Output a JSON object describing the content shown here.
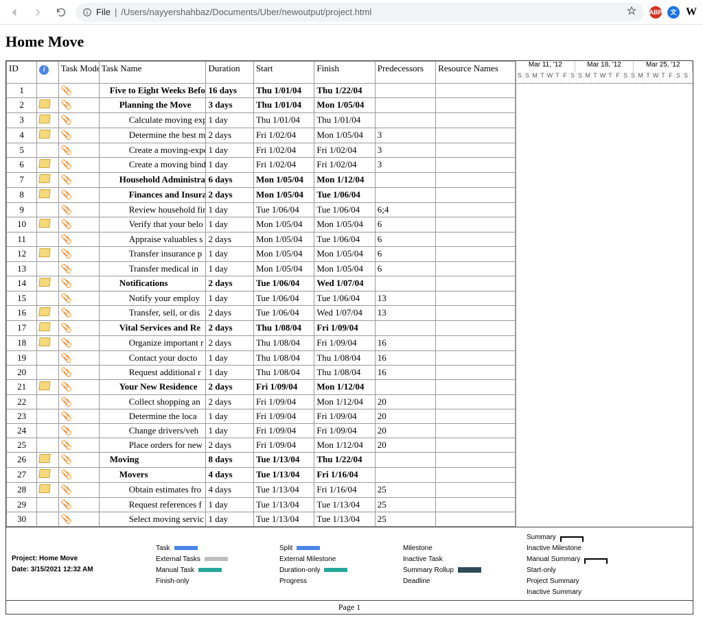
{
  "browser": {
    "file_label": "File",
    "path": "/Users/nayyershahbaz/Documents/Uber/newoutput/project.html"
  },
  "title": "Home Move",
  "columns": {
    "id": "ID",
    "info": "",
    "mode": "Task Mode",
    "name": "Task Name",
    "duration": "Duration",
    "start": "Start",
    "finish": "Finish",
    "pred": "Predecessors",
    "res": "Resource Names"
  },
  "timeline": {
    "weeks": [
      "Mar 11, '12",
      "Mar 18, '12",
      "Mar 25, '12"
    ],
    "days": [
      "S",
      "S",
      "M",
      "T",
      "W",
      "T",
      "F",
      "S",
      "S",
      "M",
      "T",
      "W",
      "T",
      "F",
      "S",
      "S",
      "M",
      "T",
      "W",
      "T",
      "F",
      "S",
      "S"
    ]
  },
  "rows": [
    {
      "id": "1",
      "note": false,
      "bold": true,
      "indent": 1,
      "name": "Five to Eight Weeks Befo",
      "dur": "16 days",
      "start": "Thu 1/01/04",
      "finish": "Thu 1/22/04",
      "pred": ""
    },
    {
      "id": "2",
      "note": true,
      "bold": true,
      "indent": 2,
      "name": "Planning the Move",
      "dur": "3 days",
      "start": "Thu 1/01/04",
      "finish": "Mon 1/05/04",
      "pred": ""
    },
    {
      "id": "3",
      "note": true,
      "bold": false,
      "indent": 3,
      "name": "Calculate moving exp",
      "dur": "1 day",
      "start": "Thu 1/01/04",
      "finish": "Thu 1/01/04",
      "pred": ""
    },
    {
      "id": "4",
      "note": true,
      "bold": false,
      "indent": 3,
      "name": "Determine the best m",
      "dur": "2 days",
      "start": "Fri 1/02/04",
      "finish": "Mon 1/05/04",
      "pred": "3"
    },
    {
      "id": "5",
      "note": false,
      "bold": false,
      "indent": 3,
      "name": "Create a moving-expe",
      "dur": "1 day",
      "start": "Fri 1/02/04",
      "finish": "Fri 1/02/04",
      "pred": "3"
    },
    {
      "id": "6",
      "note": true,
      "bold": false,
      "indent": 3,
      "name": "Create a moving bind",
      "dur": "1 day",
      "start": "Fri 1/02/04",
      "finish": "Fri 1/02/04",
      "pred": "3"
    },
    {
      "id": "7",
      "note": true,
      "bold": true,
      "indent": 2,
      "name": "Household Administrati",
      "dur": "6 days",
      "start": "Mon 1/05/04",
      "finish": "Mon 1/12/04",
      "pred": ""
    },
    {
      "id": "8",
      "note": true,
      "bold": true,
      "indent": 3,
      "name": "Finances and Insuran",
      "dur": "2 days",
      "start": "Mon 1/05/04",
      "finish": "Tue 1/06/04",
      "pred": ""
    },
    {
      "id": "9",
      "note": false,
      "bold": false,
      "indent": 3,
      "name": "Review household fin",
      "dur": "1 day",
      "start": "Tue 1/06/04",
      "finish": "Tue 1/06/04",
      "pred": "6;4"
    },
    {
      "id": "10",
      "note": true,
      "bold": false,
      "indent": 3,
      "name": "Verify that your belo",
      "dur": "1 day",
      "start": "Mon 1/05/04",
      "finish": "Mon 1/05/04",
      "pred": "6"
    },
    {
      "id": "11",
      "note": false,
      "bold": false,
      "indent": 3,
      "name": "Appraise valuables s",
      "dur": "2 days",
      "start": "Mon 1/05/04",
      "finish": "Tue 1/06/04",
      "pred": "6"
    },
    {
      "id": "12",
      "note": true,
      "bold": false,
      "indent": 3,
      "name": "Transfer insurance p",
      "dur": "1 day",
      "start": "Mon 1/05/04",
      "finish": "Mon 1/05/04",
      "pred": "6"
    },
    {
      "id": "13",
      "note": false,
      "bold": false,
      "indent": 3,
      "name": "Transfer medical in",
      "dur": "1 day",
      "start": "Mon 1/05/04",
      "finish": "Mon 1/05/04",
      "pred": "6"
    },
    {
      "id": "14",
      "note": true,
      "bold": true,
      "indent": 2,
      "name": "Notifications",
      "dur": "2 days",
      "start": "Tue 1/06/04",
      "finish": "Wed 1/07/04",
      "pred": ""
    },
    {
      "id": "15",
      "note": false,
      "bold": false,
      "indent": 3,
      "name": "Notify your employ",
      "dur": "1 day",
      "start": "Tue 1/06/04",
      "finish": "Tue 1/06/04",
      "pred": "13"
    },
    {
      "id": "16",
      "note": true,
      "bold": false,
      "indent": 3,
      "name": "Transfer, sell, or dis",
      "dur": "2 days",
      "start": "Tue 1/06/04",
      "finish": "Wed 1/07/04",
      "pred": "13"
    },
    {
      "id": "17",
      "note": true,
      "bold": true,
      "indent": 2,
      "name": "Vital Services and Re",
      "dur": "2 days",
      "start": "Thu 1/08/04",
      "finish": "Fri 1/09/04",
      "pred": ""
    },
    {
      "id": "18",
      "note": true,
      "bold": false,
      "indent": 3,
      "name": "Organize important r",
      "dur": "2 days",
      "start": "Thu 1/08/04",
      "finish": "Fri 1/09/04",
      "pred": "16"
    },
    {
      "id": "19",
      "note": false,
      "bold": false,
      "indent": 3,
      "name": "Contact your docto",
      "dur": "1 day",
      "start": "Thu 1/08/04",
      "finish": "Thu 1/08/04",
      "pred": "16"
    },
    {
      "id": "20",
      "note": false,
      "bold": false,
      "indent": 3,
      "name": "Request additional r",
      "dur": "1 day",
      "start": "Thu 1/08/04",
      "finish": "Thu 1/08/04",
      "pred": "16"
    },
    {
      "id": "21",
      "note": true,
      "bold": true,
      "indent": 2,
      "name": "Your New Residence",
      "dur": "2 days",
      "start": "Fri 1/09/04",
      "finish": "Mon 1/12/04",
      "pred": ""
    },
    {
      "id": "22",
      "note": false,
      "bold": false,
      "indent": 3,
      "name": "Collect shopping an",
      "dur": "2 days",
      "start": "Fri 1/09/04",
      "finish": "Mon 1/12/04",
      "pred": "20"
    },
    {
      "id": "23",
      "note": false,
      "bold": false,
      "indent": 3,
      "name": "Determine the loca",
      "dur": "1 day",
      "start": "Fri 1/09/04",
      "finish": "Fri 1/09/04",
      "pred": "20"
    },
    {
      "id": "24",
      "note": false,
      "bold": false,
      "indent": 3,
      "name": "Change drivers/veh",
      "dur": "1 day",
      "start": "Fri 1/09/04",
      "finish": "Fri 1/09/04",
      "pred": "20"
    },
    {
      "id": "25",
      "note": false,
      "bold": false,
      "indent": 3,
      "name": "Place orders for new",
      "dur": "2 days",
      "start": "Fri 1/09/04",
      "finish": "Mon 1/12/04",
      "pred": "20"
    },
    {
      "id": "26",
      "note": true,
      "bold": true,
      "indent": 1,
      "name": "Moving",
      "dur": "8 days",
      "start": "Tue 1/13/04",
      "finish": "Thu 1/22/04",
      "pred": ""
    },
    {
      "id": "27",
      "note": true,
      "bold": true,
      "indent": 2,
      "name": "Movers",
      "dur": "4 days",
      "start": "Tue 1/13/04",
      "finish": "Fri 1/16/04",
      "pred": ""
    },
    {
      "id": "28",
      "note": true,
      "bold": false,
      "indent": 3,
      "name": "Obtain estimates fro",
      "dur": "4 days",
      "start": "Tue 1/13/04",
      "finish": "Fri 1/16/04",
      "pred": "25"
    },
    {
      "id": "29",
      "note": false,
      "bold": false,
      "indent": 3,
      "name": "Request references f",
      "dur": "1 day",
      "start": "Tue 1/13/04",
      "finish": "Tue 1/13/04",
      "pred": "25"
    },
    {
      "id": "30",
      "note": false,
      "bold": false,
      "indent": 3,
      "name": "Select moving servic",
      "dur": "1 day",
      "start": "Tue 1/13/04",
      "finish": "Tue 1/13/04",
      "pred": "25"
    }
  ],
  "legend": {
    "project_label": "Project: Home Move",
    "date_label": "Date: 3/15/2021 12:32 AM",
    "items_col1": [
      "Task",
      "External Tasks",
      "Manual Task",
      "Finish-only"
    ],
    "items_col2": [
      "Split",
      "External Milestone",
      "Duration-only",
      "Progress"
    ],
    "items_col3": [
      "Milestone",
      "Inactive Task",
      "Summary Rollup",
      "Deadline"
    ],
    "items_col4": [
      "Summary",
      "Inactive Milestone",
      "Manual Summary",
      "Start-only"
    ],
    "items_col5": [
      "Project Summary",
      "Inactive Summary",
      "",
      ""
    ]
  },
  "footer": "Page 1"
}
